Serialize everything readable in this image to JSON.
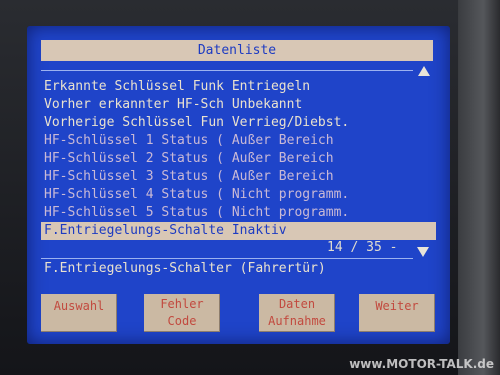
{
  "screen": {
    "title": "Datenliste",
    "rows": [
      "Erkannte Schlüssel Funk Entriegeln",
      "Vorher erkannter HF-Sch Unbekannt",
      "Vorherige Schlüssel Fun Verrieg/Diebst.",
      "HF-Schlüssel 1 Status ( Außer Bereich",
      "HF-Schlüssel 2 Status ( Außer Bereich",
      "HF-Schlüssel 3 Status ( Außer Bereich",
      "HF-Schlüssel 4 Status ( Nicht programm.",
      "HF-Schlüssel 5 Status ( Nicht programm.",
      "F.Entriegelungs-Schalte Inaktiv"
    ],
    "counter": "14 / 35 -",
    "description": "F.Entriegelungs-Schalter (Fahrertür)"
  },
  "softkeys": [
    "Auswahl",
    "Fehler\nCode",
    "Daten\nAufnahme",
    "Weiter"
  ],
  "watermark": "www.MOTOR-TALK.de",
  "colors": {
    "screen_bg": "#1f44c9",
    "highlight_bg": "#d8c7b5",
    "softkey_bg": "#cbb9a3",
    "softkey_text": "#c24a3f"
  },
  "icons": [
    "scroll-up-arrow-icon",
    "scroll-down-arrow-icon"
  ]
}
